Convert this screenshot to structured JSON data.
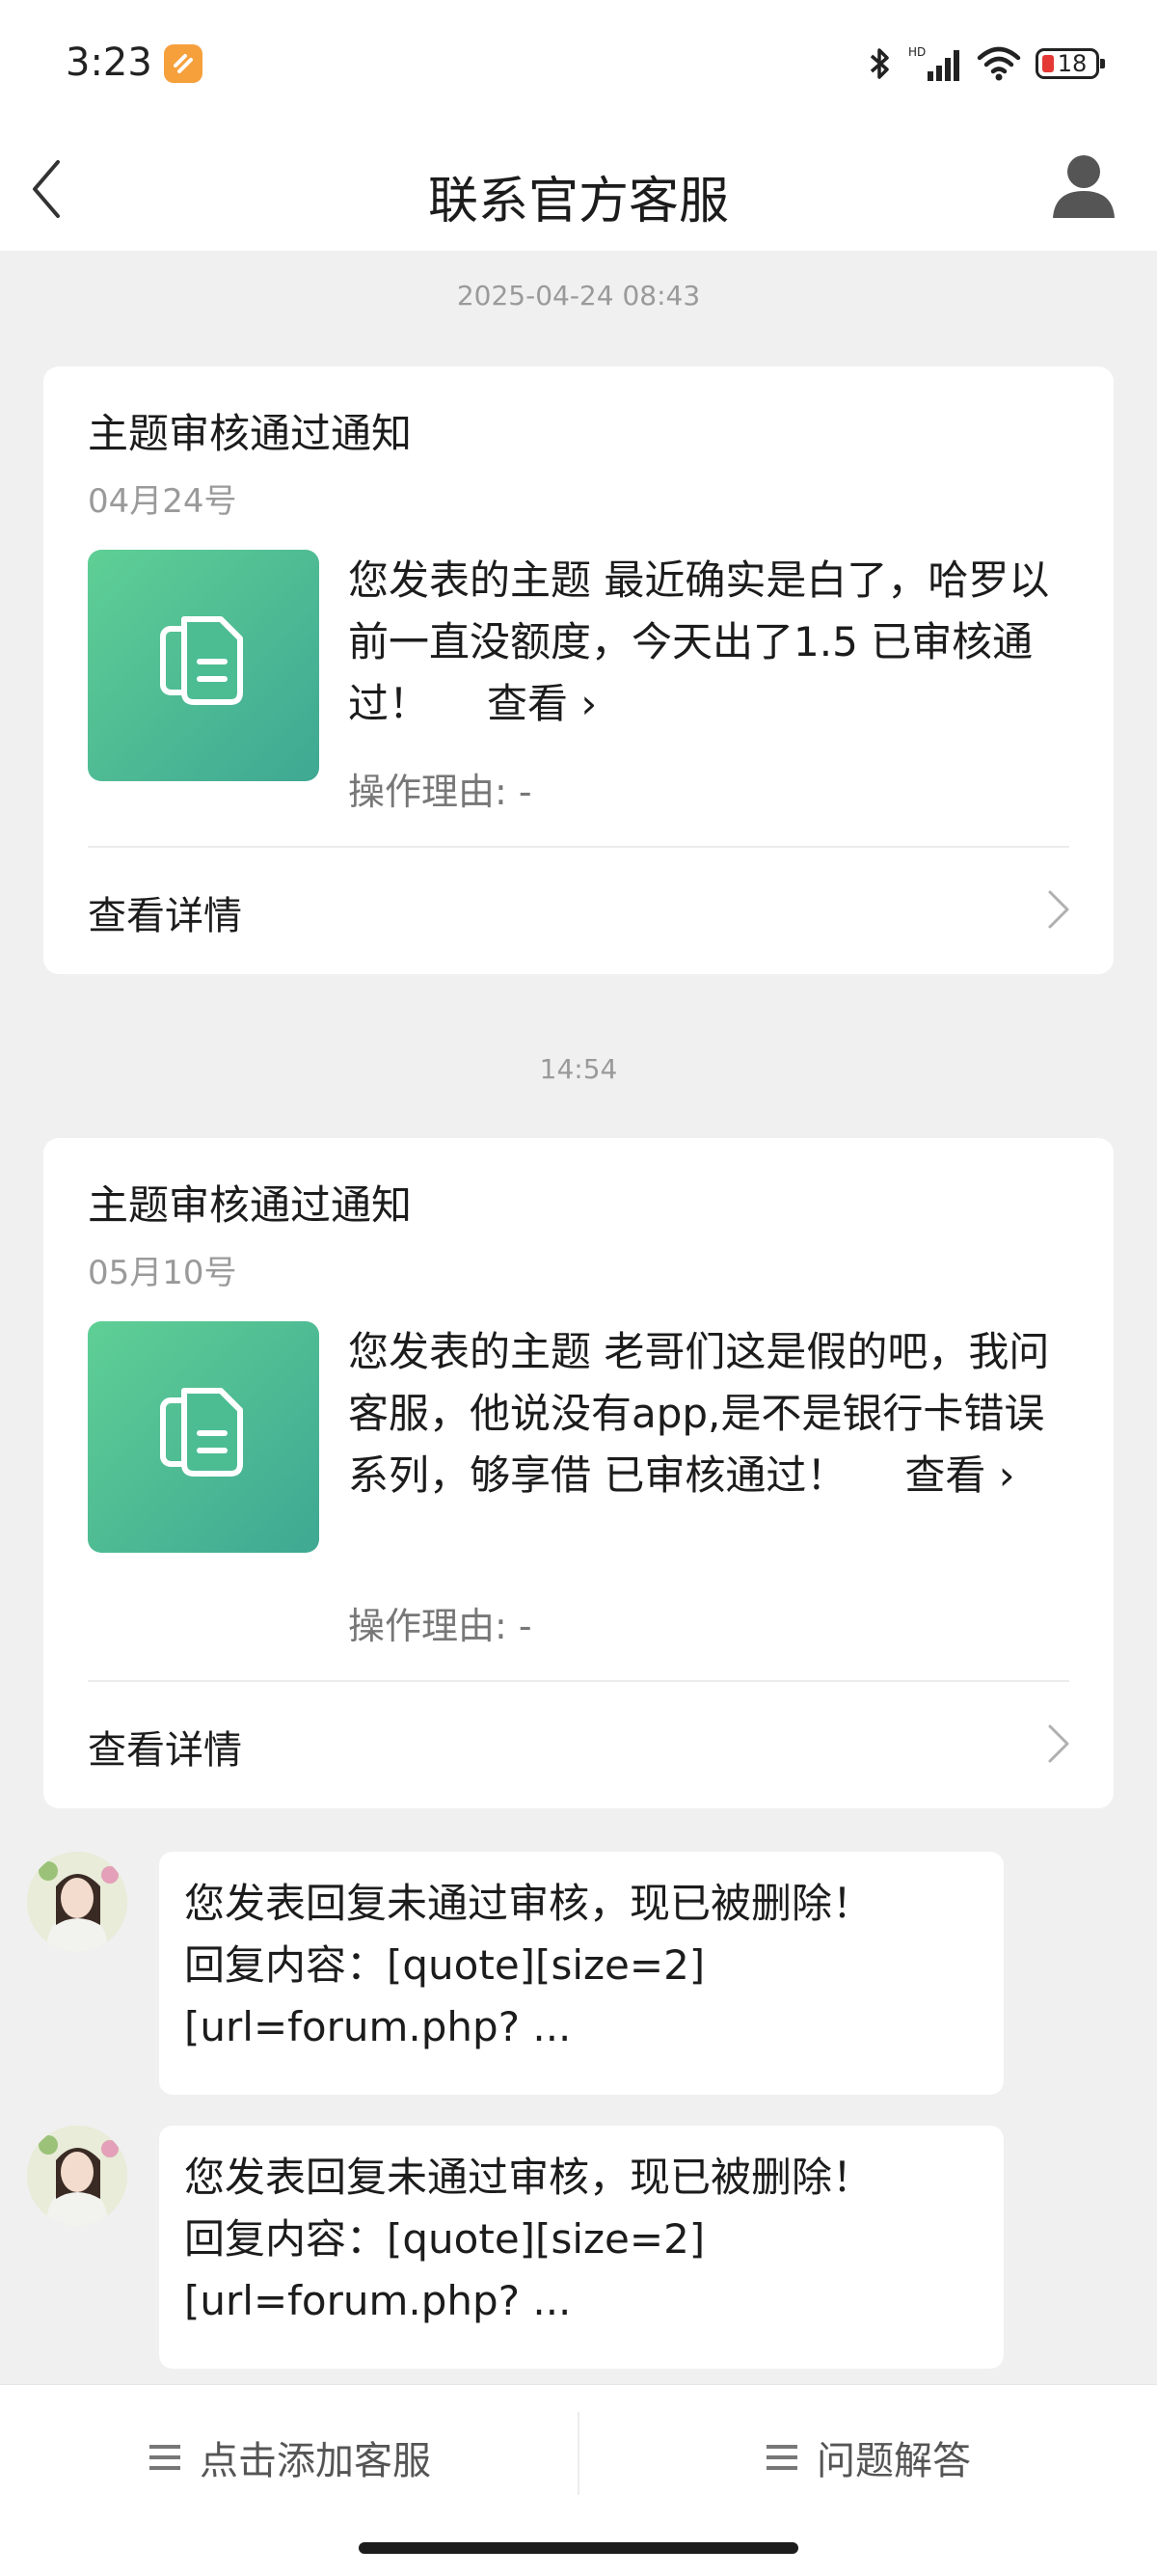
{
  "status_bar": {
    "time": "3:23",
    "battery": "18",
    "icons": [
      "orange-app-icon",
      "bluetooth-icon",
      "cellular-signal-icon",
      "wifi-icon",
      "battery-icon"
    ]
  },
  "header": {
    "title": "联系官方客服",
    "back_icon": "chevron-left-icon",
    "profile_icon": "person-icon"
  },
  "messages": [
    {
      "timestamp": "2025-04-24 08:43",
      "card": {
        "title": "主题审核通过通知",
        "date": "04月24号",
        "body": "您发表的主题 最近确实是白了，哈罗以前一直没额度，今天出了1.5 已审核通过！",
        "view_link": "查看 ›",
        "reason": "操作理由: -",
        "detail_label": "查看详情"
      }
    },
    {
      "timestamp": "14:54",
      "card": {
        "title": "主题审核通过通知",
        "date": "05月10号",
        "body": "您发表的主题 老哥们这是假的吧，我问客服，他说没有app,是不是银行卡错误系列，够享借 已审核通过！",
        "view_link": "查看 ›",
        "reason": "操作理由: -",
        "detail_label": "查看详情"
      }
    }
  ],
  "chat": [
    {
      "text": "您发表回复未通过审核，现已被删除！ 回复内容：[quote][size=2][url=forum.php? ..."
    },
    {
      "text": "您发表回复未通过审核，现已被删除！ 回复内容：[quote][size=2][url=forum.php? ..."
    }
  ],
  "bottom_bar": {
    "left_label": "点击添加客服",
    "right_label": "问题解答",
    "menu_icon": "menu-icon"
  },
  "colors": {
    "background": "#f0f0f0",
    "card": "#ffffff",
    "thumb_gradient_start": "#5fcf95",
    "thumb_gradient_end": "#3fa893",
    "battery_low": "#e53935"
  }
}
